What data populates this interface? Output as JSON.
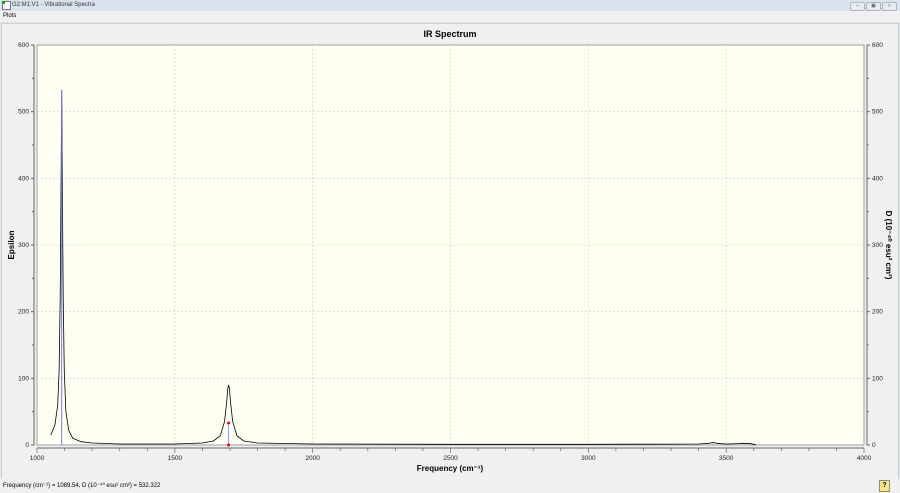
{
  "window": {
    "title": "G2:M1:V1 - Vibrational Spectra",
    "buttons": [
      "minimize",
      "restore",
      "maximize"
    ]
  },
  "menu": {
    "items": [
      "Plots"
    ]
  },
  "status": {
    "text": "Frequency (cm⁻¹) = 1089.54, D (10⁻⁴⁰ esu² cm²) = 532.322",
    "help_icon": "help-icon"
  },
  "colors": {
    "plot_bg": "#fffff2",
    "spectrum": "#000000",
    "stick_selected": "#6f7bff",
    "stick": "#8899ff",
    "marker": "#ff0000"
  },
  "chart_data": {
    "type": "line",
    "title": "IR Spectrum",
    "xlabel": "Frequency (cm⁻¹)",
    "ylabel": "Epsilon",
    "y2label": "D (10⁻⁴⁰ esu² cm²)",
    "xlim": [
      1000,
      4000
    ],
    "ylim": [
      0,
      600
    ],
    "y2lim": [
      0,
      600
    ],
    "xticks": [
      "1000",
      "1500",
      "2000",
      "2500",
      "3000",
      "3500",
      "4000"
    ],
    "yticks": [
      "0",
      "100",
      "200",
      "300",
      "400",
      "500",
      "600"
    ],
    "y2ticks": [
      "0",
      "100",
      "200",
      "300",
      "400",
      "500",
      "600"
    ],
    "grid": true,
    "spectrum": {
      "x": [
        1050,
        1065,
        1075,
        1080,
        1084,
        1087,
        1089.5,
        1092,
        1095,
        1099,
        1105,
        1115,
        1130,
        1160,
        1200,
        1300,
        1500,
        1600,
        1640,
        1665,
        1680,
        1688,
        1692,
        1695,
        1698,
        1702,
        1710,
        1725,
        1750,
        1800,
        2000,
        2500,
        3000,
        3400,
        3440,
        3452,
        3465,
        3500,
        3540,
        3560,
        3590,
        3610
      ],
      "y": [
        15,
        30,
        60,
        110,
        220,
        380,
        532,
        380,
        220,
        110,
        50,
        22,
        10,
        5,
        3,
        1.5,
        1.5,
        3,
        6,
        14,
        35,
        65,
        85,
        90,
        85,
        65,
        35,
        14,
        6,
        3,
        1.5,
        1,
        1,
        1.5,
        2.5,
        4,
        2.5,
        1.5,
        2,
        2.5,
        2,
        0
      ]
    },
    "sticks": [
      {
        "x": 1089.54,
        "d": 532.322,
        "selected": true
      },
      {
        "x": 1695,
        "d": 33,
        "selected": false
      },
      {
        "x": 3452,
        "d": 3,
        "selected": false
      }
    ]
  }
}
